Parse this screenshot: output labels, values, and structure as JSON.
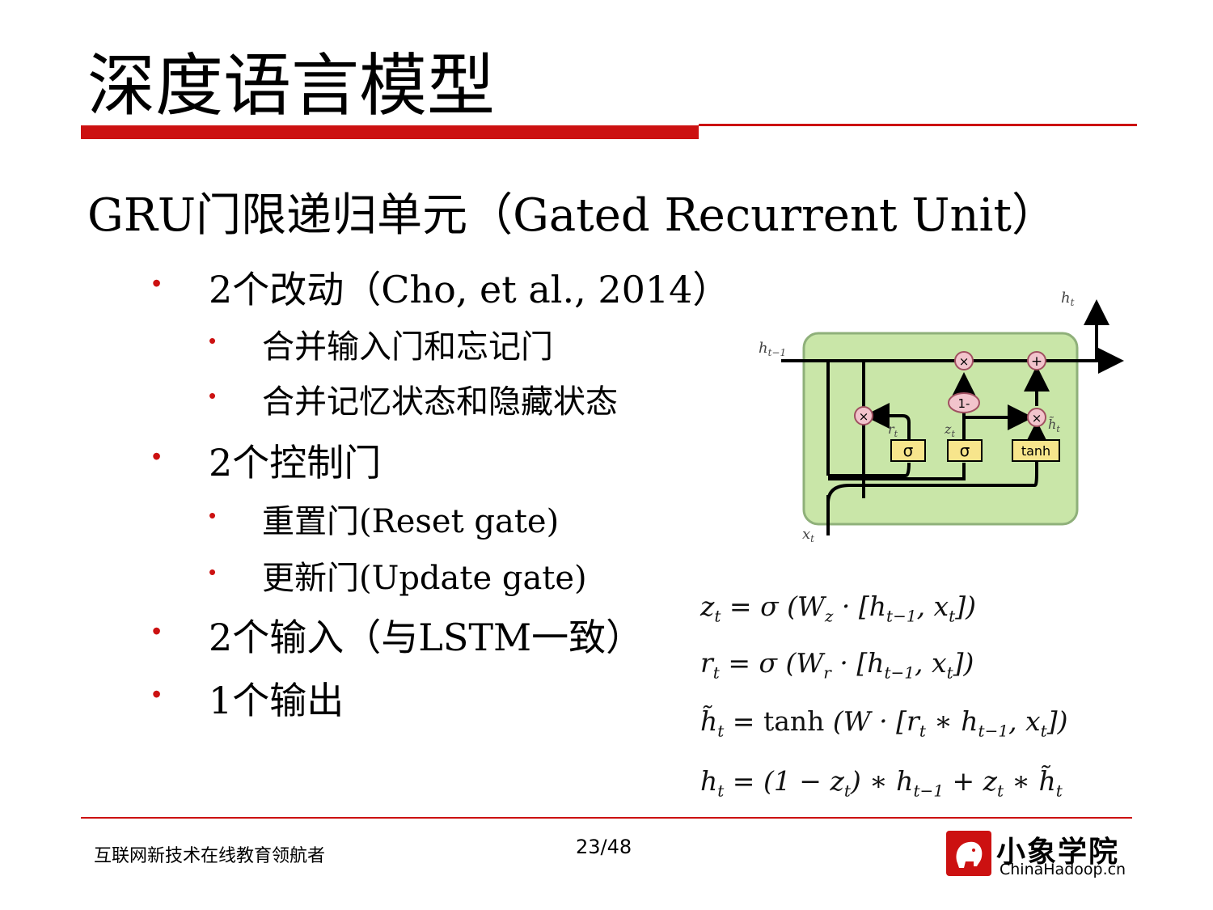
{
  "title": "深度语言模型",
  "heading": "GRU门限递归单元（Gated Recurrent Unit）",
  "bullets": [
    {
      "text": "2个改动（Cho, et al., 2014）",
      "children": [
        "合并输入门和忘记门",
        "合并记忆状态和隐藏状态"
      ]
    },
    {
      "text": "2个控制门",
      "children": [
        "重置门(Reset gate)",
        "更新门(Update gate)"
      ]
    },
    {
      "text": "2个输入（与LSTM一致）",
      "children": []
    },
    {
      "text": "1个输出",
      "children": []
    }
  ],
  "bullet_symbol": "•",
  "diagram": {
    "input_h": "h",
    "input_h_sub": "t−1",
    "output_h": "h",
    "output_h_sub": "t",
    "input_x": "x",
    "input_x_sub": "t",
    "reset_gate": "σ",
    "update_gate": "σ",
    "candidate": "tanh",
    "one_minus": "1-",
    "mult": "×",
    "plus": "+",
    "r_label": "r",
    "r_sub": "t",
    "z_label": "z",
    "z_sub": "t",
    "htilde_label": "h̃",
    "htilde_sub": "t",
    "box_color": "#c9e6a8",
    "gate_color": "#f7e58c",
    "op_color": "#f2c4cc"
  },
  "equations": [
    "z_t = σ (W_z · [h_{t−1}, x_t])",
    "r_t = σ (W_r · [h_{t−1}, x_t])",
    "h̃_t = tanh (W · [r_t ∗ h_{t−1}, x_t])",
    "h_t = (1 − z_t) ∗ h_{t−1} + z_t ∗ h̃_t"
  ],
  "footer": {
    "tagline": "互联网新技术在线教育领航者",
    "page": "23/48",
    "logo_name": "小象学院",
    "logo_domain": "ChinaHadoop.cn"
  },
  "accent_color": "#cc1111"
}
